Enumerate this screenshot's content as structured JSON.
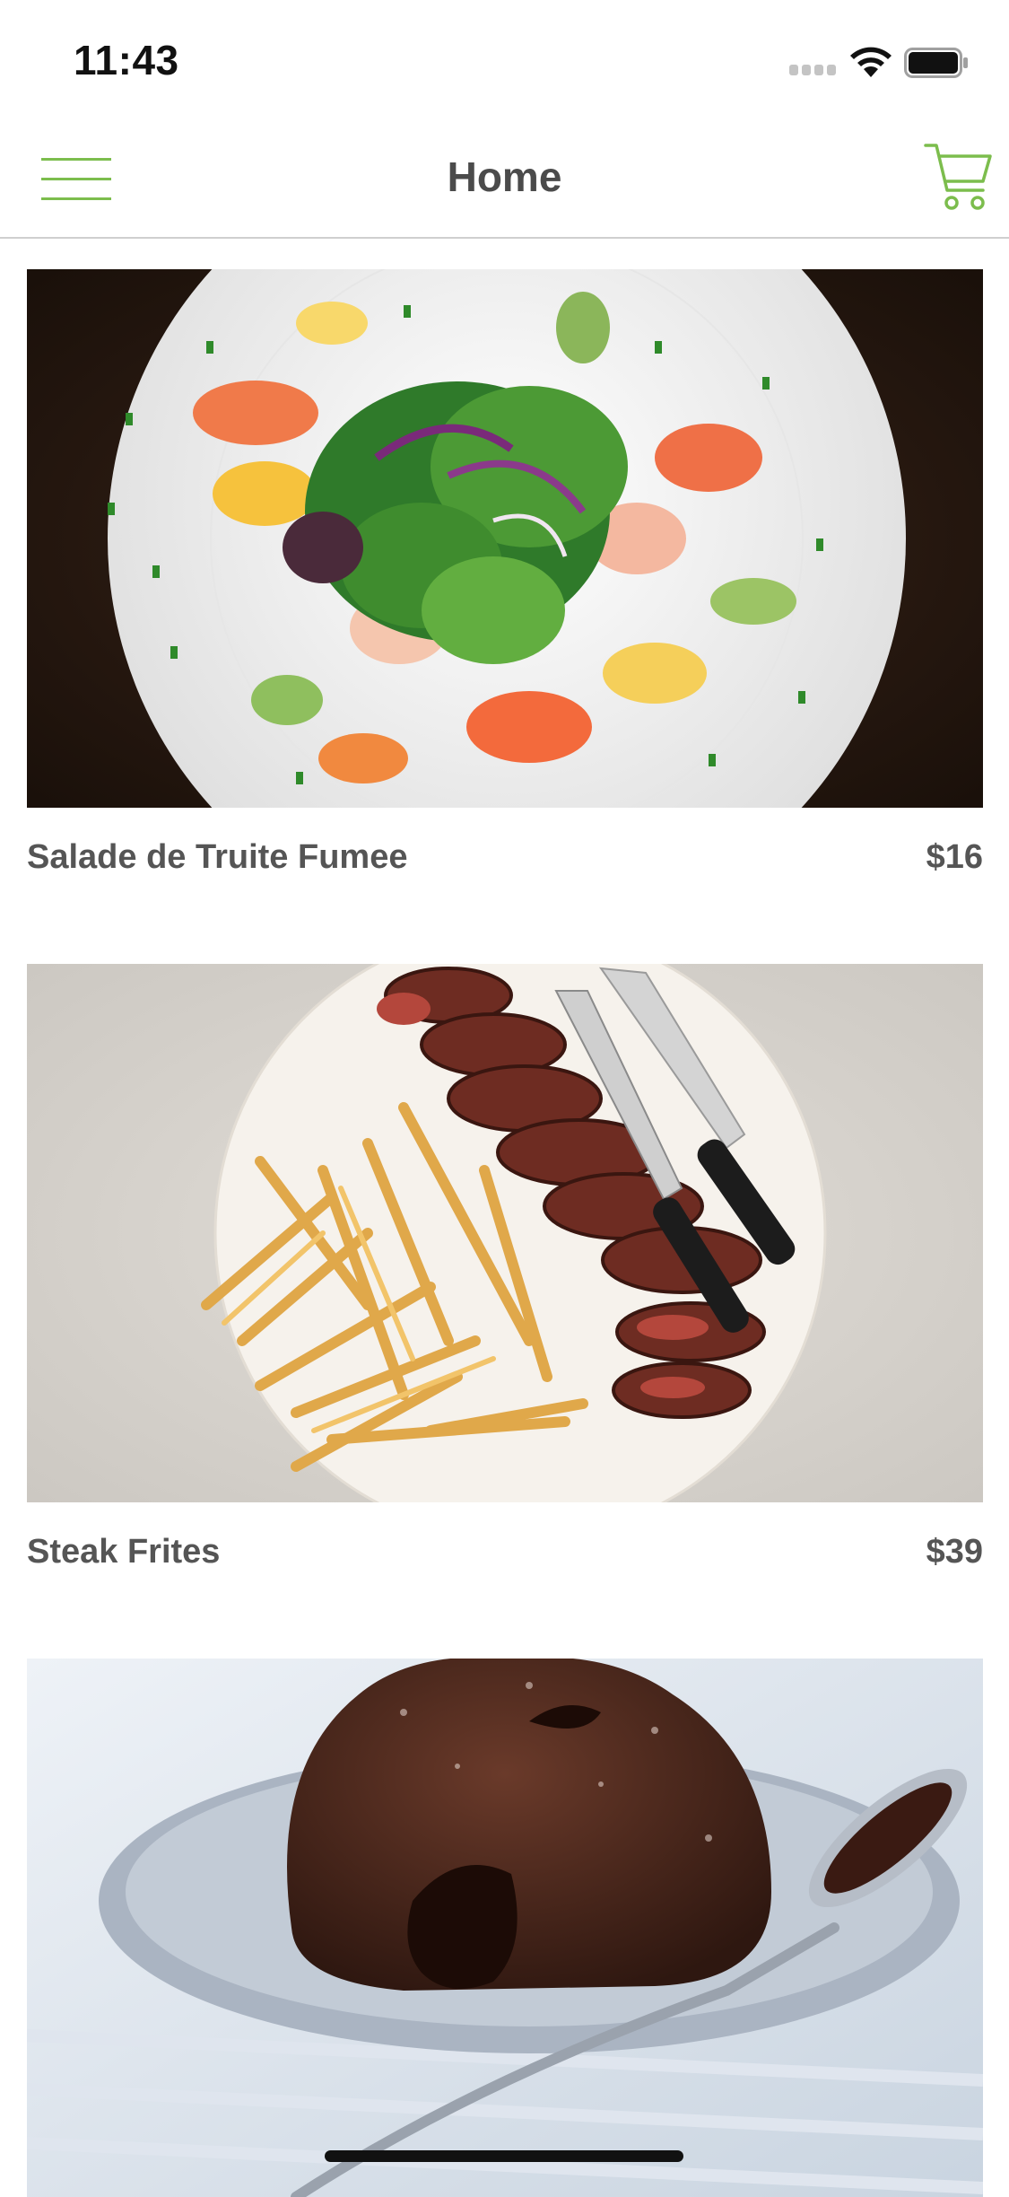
{
  "status_bar": {
    "time": "11:43"
  },
  "nav": {
    "title": "Home",
    "menu_icon": "hamburger-menu-icon",
    "cart_icon": "shopping-cart-icon"
  },
  "colors": {
    "accent": "#7cbd4d",
    "text": "#555555",
    "divider": "#cfcfcf"
  },
  "menu_items": [
    {
      "name": "Salade de Truite Fumee",
      "price": "$16"
    },
    {
      "name": "Steak Frites",
      "price": "$39"
    },
    {
      "name": "",
      "price": ""
    }
  ]
}
